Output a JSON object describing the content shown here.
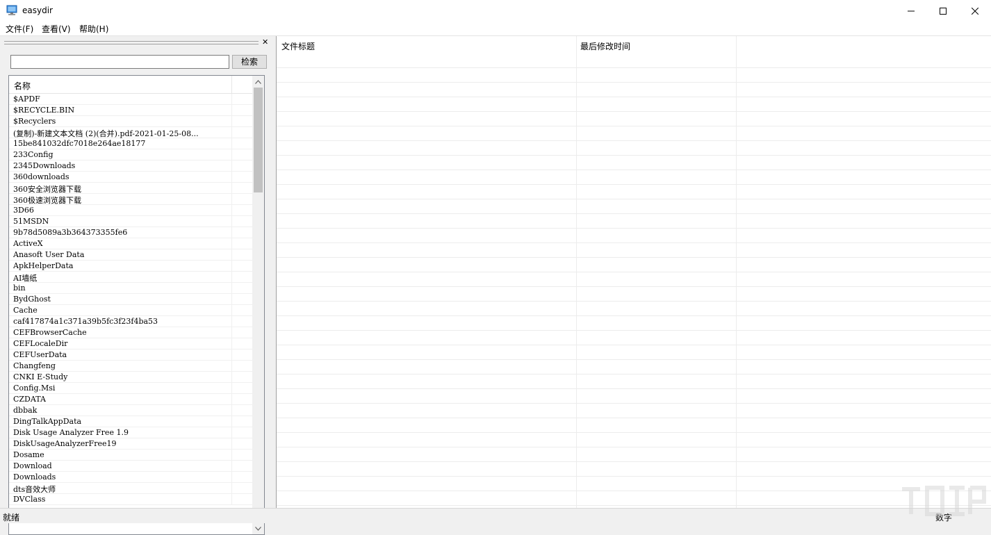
{
  "window": {
    "title": "easydir",
    "minimize_icon": "minimize-icon",
    "maximize_icon": "maximize-icon",
    "close_icon": "close-icon"
  },
  "menubar": {
    "file": "文件(F)",
    "view": "查看(V)",
    "help": "帮助(H)"
  },
  "left_pane": {
    "close_glyph": "✕",
    "search": {
      "value": "",
      "placeholder": "",
      "button_label": "检索"
    },
    "list_header": "名称",
    "items": [
      "$APDF",
      "$RECYCLE.BIN",
      "$Recyclers",
      "(复制)-新建文本文档 (2)(合并).pdf-2021-01-25-08...",
      "15be841032dfc7018e264ae18177",
      "233Config",
      "2345Downloads",
      "360downloads",
      "360安全浏览器下载",
      "360极速浏览器下载",
      "3D66",
      "51MSDN",
      "9b78d5089a3b364373355fe6",
      "ActiveX",
      "Anasoft User Data",
      "ApkHelperData",
      "AI墙纸",
      "bin",
      "BydGhost",
      "Cache",
      "caf417874a1c371a39b5fc3f23f4ba53",
      "CEFBrowserCache",
      "CEFLocaleDir",
      "CEFUserData",
      "Changfeng",
      "CNKI E-Study",
      "Config.Msi",
      "CZDATA",
      "dbbak",
      "DingTalkAppData",
      "Disk Usage Analyzer Free 1.9",
      "DiskUsageAnalyzerFree19",
      "Dosame",
      "Download",
      "Downloads",
      "dts音效大师",
      "DVClass"
    ]
  },
  "right_pane": {
    "columns": [
      "文件标题",
      "最后修改时间",
      ""
    ]
  },
  "statusbar": {
    "left": "就绪",
    "right": "数字"
  }
}
